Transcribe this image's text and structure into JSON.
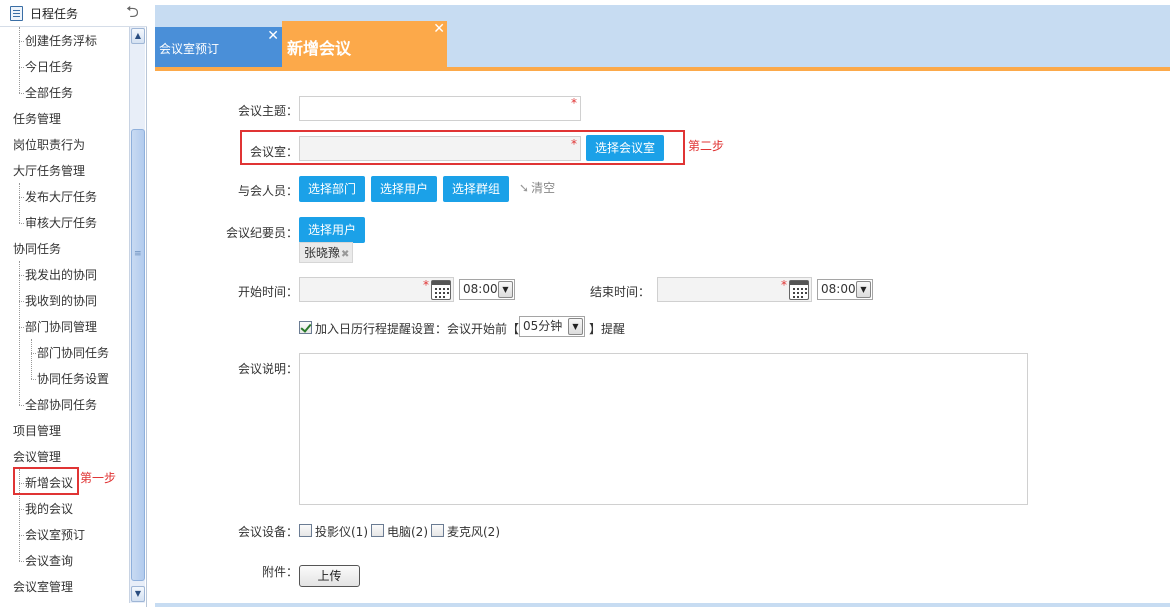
{
  "sidebar": {
    "header_title": "日程任务",
    "header_icon": "calendar-icon",
    "back_icon": "undo-arrow-icon",
    "items": [
      {
        "label": "创建任务浮标"
      },
      {
        "label": "今日任务"
      },
      {
        "label": "全部任务"
      },
      {
        "label": "任务管理"
      },
      {
        "label": "岗位职责行为"
      },
      {
        "label": "大厅任务管理"
      },
      {
        "label": "发布大厅任务"
      },
      {
        "label": "审核大厅任务"
      },
      {
        "label": "协同任务"
      },
      {
        "label": "我发出的协同"
      },
      {
        "label": "我收到的协同"
      },
      {
        "label": "部门协同管理"
      },
      {
        "label": "部门协同任务"
      },
      {
        "label": "协同任务设置"
      },
      {
        "label": "全部协同任务"
      },
      {
        "label": "项目管理"
      },
      {
        "label": "会议管理"
      },
      {
        "label": "新增会议"
      },
      {
        "label": "我的会议"
      },
      {
        "label": "会议室预订"
      },
      {
        "label": "会议查询"
      },
      {
        "label": "会议室管理"
      }
    ],
    "step1_label": "第一步"
  },
  "tabs": [
    {
      "label": "会议室预订",
      "close": "✕"
    },
    {
      "label": "新增会议",
      "close": "✕"
    }
  ],
  "form": {
    "subject_label": "会议主题：",
    "room_label": "会议室：",
    "select_room_button": "选择会议室",
    "step2_label": "第二步",
    "attendees_label": "与会人员：",
    "select_dept_button": "选择部门",
    "select_user_button": "选择用户",
    "select_group_button": "选择群组",
    "clear_label": "清空",
    "recorder_label": "会议纪要员：",
    "recorder_select_button": "选择用户",
    "recorder_tag": "张晓豫",
    "start_label": "开始时间：",
    "start_time": "08:00",
    "end_label": "结束时间：",
    "end_time": "08:00",
    "calendar_check_label": "加入日历行程提醒设置：会议开始前【",
    "reminder_value": "05分钟",
    "reminder_suffix": "】提醒",
    "desc_label": "会议说明：",
    "equipment_label": "会议设备：",
    "equipment": [
      {
        "label": "投影仪(1)"
      },
      {
        "label": "电脑(2)"
      },
      {
        "label": "麦克风(2)"
      }
    ],
    "attachment_label": "附件：",
    "upload_button": "上传",
    "required_mark": "*"
  },
  "colors": {
    "accent_blue": "#1ba1e8",
    "tab_orange": "#fca94a",
    "tab_blue": "#4a8fd8",
    "highlight_red": "#e03434"
  }
}
